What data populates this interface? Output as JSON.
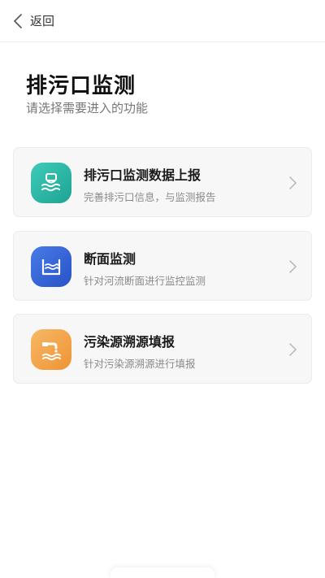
{
  "nav": {
    "back_label": "返回"
  },
  "page": {
    "title": "排污口监测",
    "subtitle": "请选择需要进入的功能"
  },
  "cards": [
    {
      "title": "排污口监测数据上报",
      "description": "完善排污口信息，与监测报告",
      "icon": "outfall-icon",
      "color": "#2bb8a8"
    },
    {
      "title": "断面监测",
      "description": "针对河流断面进行监控监测",
      "icon": "river-section-icon",
      "color": "#3565d9"
    },
    {
      "title": "污染源溯源填报",
      "description": "针对污染源溯源进行填报",
      "icon": "pollution-source-icon",
      "color": "#f2a54a"
    }
  ]
}
